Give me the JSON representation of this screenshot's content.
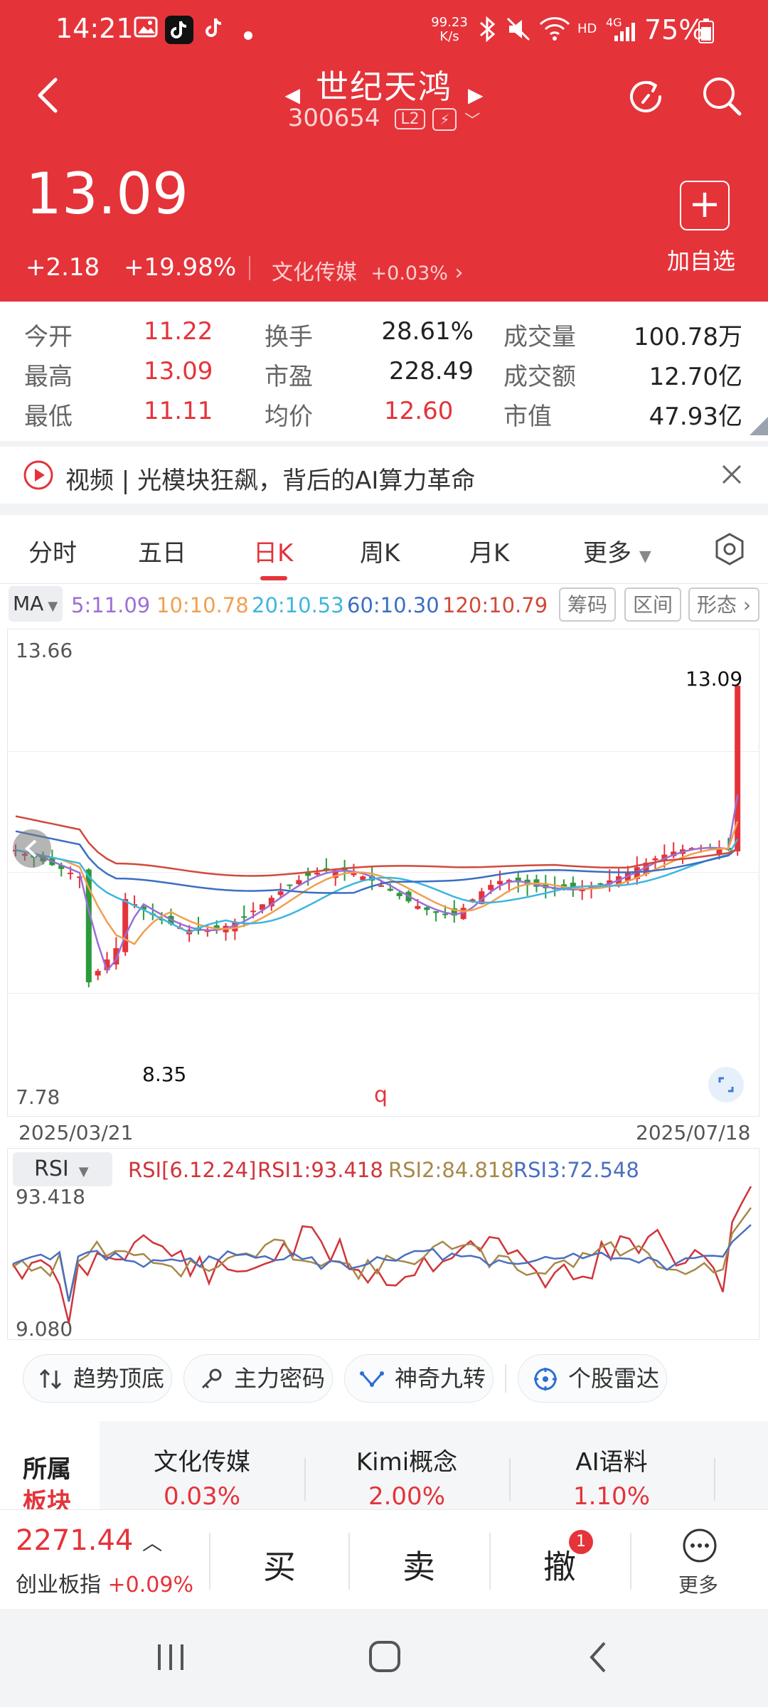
{
  "status": {
    "time": "14:21",
    "net_speed_top": "99.23",
    "net_speed_unit": "K/s",
    "hd": "HD",
    "net_type": "4G",
    "battery": "75%"
  },
  "header": {
    "title": "世纪天鸿",
    "code": "300654",
    "l2": "L2"
  },
  "quote": {
    "price": "13.09",
    "change": "+2.18",
    "change_pct": "+19.98%",
    "sector_name": "文化传媒",
    "sector_pct": "+0.03%",
    "add_label": "加自选"
  },
  "stats": [
    {
      "label": "今开",
      "value": "11.22"
    },
    {
      "label": "换手",
      "value": "28.61%"
    },
    {
      "label": "成交量",
      "value": "100.78万"
    },
    {
      "label": "最高",
      "value": "13.09"
    },
    {
      "label": "市盈",
      "value": "228.49"
    },
    {
      "label": "成交额",
      "value": "12.70亿"
    },
    {
      "label": "最低",
      "value": "11.11"
    },
    {
      "label": "均价",
      "value": "12.60"
    },
    {
      "label": "市值",
      "value": "47.93亿"
    }
  ],
  "news": {
    "text": "视频 | 光模块狂飙，背后的AI算力革命"
  },
  "tabs": [
    {
      "label": "分时"
    },
    {
      "label": "五日"
    },
    {
      "label": "日K"
    },
    {
      "label": "周K"
    },
    {
      "label": "月K"
    },
    {
      "label": "更多"
    }
  ],
  "ma": {
    "badge": "MA",
    "items": [
      {
        "text": "5:11.09",
        "color": "#9b6fd6"
      },
      {
        "text": "10:10.78",
        "color": "#f0a050"
      },
      {
        "text": "20:10.53",
        "color": "#3db6e0"
      },
      {
        "text": "60:10.30",
        "color": "#3a6fc4"
      },
      {
        "text": "120:10.79",
        "color": "#d04a3a"
      }
    ],
    "pills": [
      "筹码",
      "区间",
      "形态"
    ]
  },
  "kline": {
    "y_max_label": "13.66",
    "y_min_label": "7.78",
    "high_label": "13.09",
    "low_label": "8.35",
    "date_start": "2025/03/21",
    "date_end": "2025/07/18",
    "marker": "q"
  },
  "rsi": {
    "badge": "RSI",
    "params": "RSI[6.12.24]",
    "rsi1": "RSI1:93.418",
    "rsi2": "RSI2:84.818",
    "rsi3": "RSI3:72.548",
    "y_max": "93.418",
    "y_min": "9.080"
  },
  "tools": [
    {
      "label": "趋势顶底"
    },
    {
      "label": "主力密码"
    },
    {
      "label": "神奇九转"
    },
    {
      "label": "个股雷达"
    }
  ],
  "sectors": {
    "title_top": "所属",
    "title_bottom": "板块",
    "items": [
      {
        "name": "文化传媒",
        "pct": "0.03%"
      },
      {
        "name": "Kimi概念",
        "pct": "2.00%"
      },
      {
        "name": "AI语料",
        "pct": "1.10%"
      }
    ]
  },
  "bottom": {
    "index_value": "2271.44",
    "index_name": "创业板指",
    "index_chg": "+0.09%",
    "buy": "买",
    "sell": "卖",
    "cancel": "撤",
    "badge": "1",
    "more": "更多"
  },
  "chart_data": {
    "type": "candlestick",
    "series_notes": "daily K-line with MA5/10/20/60/120 overlays; last candle is a limit-up bar",
    "ylim": [
      7.78,
      13.66
    ],
    "x_start": "2025/03/21",
    "x_end": "2025/07/18",
    "high": 13.09,
    "low": 8.35,
    "last_close": 13.09,
    "rsi": {
      "ylim": [
        9.08,
        93.418
      ],
      "rsi1": 93.418,
      "rsi2": 84.818,
      "rsi3": 72.548
    }
  }
}
